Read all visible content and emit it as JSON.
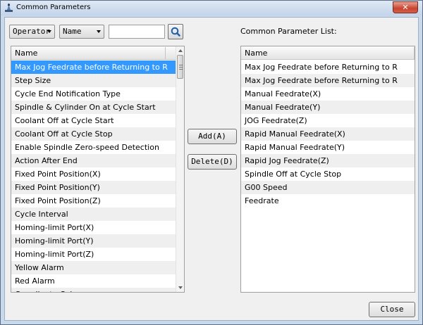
{
  "window": {
    "title": "Common Parameters",
    "close_glyph": "✕"
  },
  "toolbar": {
    "filter_dropdown": "Operator",
    "column_dropdown": "Name",
    "search_value": "",
    "search_icon": "magnifier-icon"
  },
  "left_list": {
    "header": "Name",
    "items": [
      "Max Jog Feedrate before Returning to R",
      "Step Size",
      "Cycle End Notification Type",
      "Spindle & Cylinder On at Cycle Start",
      "Coolant Off at Cycle Start",
      "Coolant Off at Cycle Stop",
      "Enable Spindle Zero-speed Detection",
      "Action After End",
      "Fixed Point Position(X)",
      "Fixed Point Position(Y)",
      "Fixed Point Position(Z)",
      "Cycle Interval",
      "Homing-limit Port(X)",
      "Homing-limit Port(Y)",
      "Homing-limit Port(Z)",
      "Yellow Alarm",
      "Red Alarm",
      "Coordinate Color"
    ],
    "selected_index": 0
  },
  "right_panel": {
    "label": "Common Parameter List:",
    "header": "Name",
    "items": [
      "Max Jog Feedrate before Returning to R",
      "Max Jog Feedrate before Returning to R",
      "Manual Feedrate(X)",
      "Manual Feedrate(Y)",
      "JOG Feedrate(Z)",
      "Rapid Manual Feedrate(X)",
      "Rapid Manual Feedrate(Y)",
      "Rapid Jog Feedrate(Z)",
      "Spindle Off at Cycle Stop",
      "G00 Speed",
      "Feedrate"
    ]
  },
  "buttons": {
    "add": "Add(A)",
    "delete": "Delete(D)",
    "close": "Close"
  }
}
